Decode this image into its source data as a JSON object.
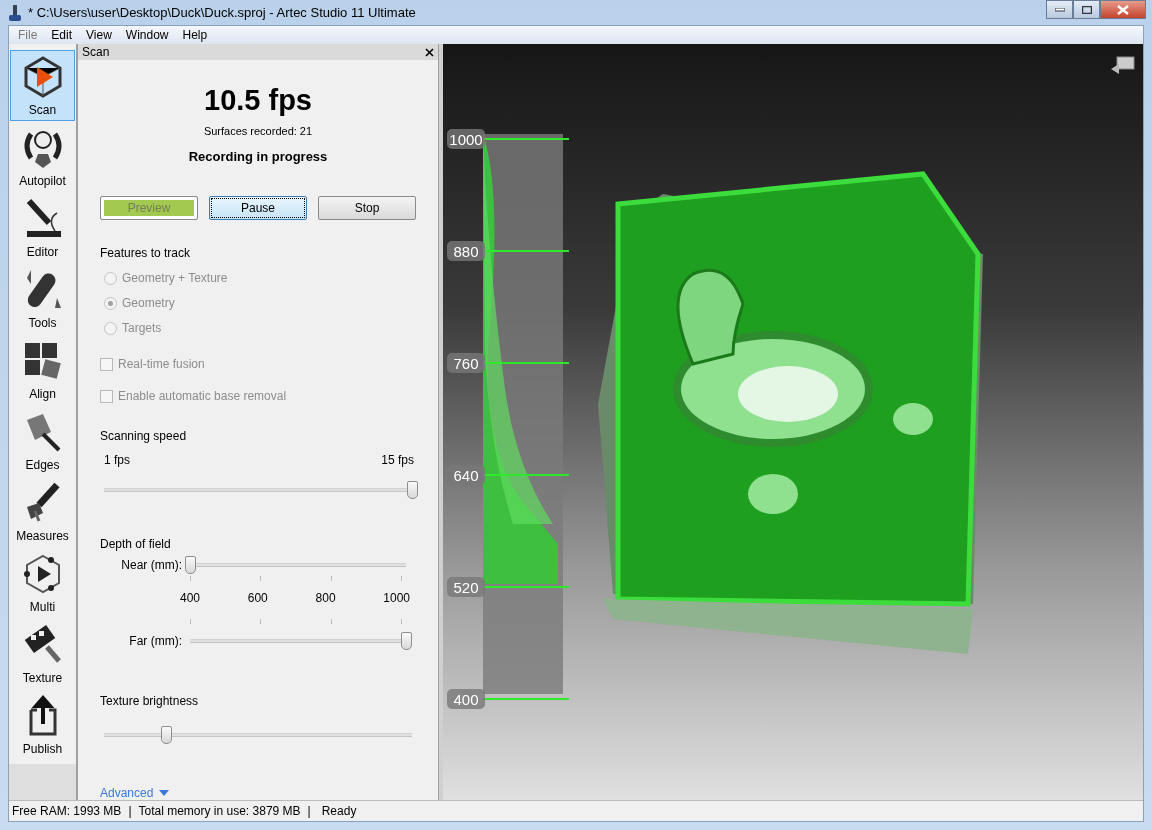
{
  "window": {
    "title": "* C:\\Users\\user\\Desktop\\Duck\\Duck.sproj - Artec Studio 11 Ultimate"
  },
  "menu": [
    {
      "label": "File",
      "disabled": true
    },
    {
      "label": "Edit",
      "disabled": false
    },
    {
      "label": "View",
      "disabled": false
    },
    {
      "label": "Window",
      "disabled": false
    },
    {
      "label": "Help",
      "disabled": false
    }
  ],
  "toolbar": [
    {
      "label": "Scan",
      "selected": true
    },
    {
      "label": "Autopilot",
      "selected": false
    },
    {
      "label": "Editor",
      "selected": false
    },
    {
      "label": "Tools",
      "selected": false
    },
    {
      "label": "Align",
      "selected": false
    },
    {
      "label": "Edges",
      "selected": false
    },
    {
      "label": "Measures",
      "selected": false
    },
    {
      "label": "Multi",
      "selected": false
    },
    {
      "label": "Texture",
      "selected": false
    },
    {
      "label": "Publish",
      "selected": false
    }
  ],
  "panel": {
    "title": "Scan",
    "fps": "10.5 fps",
    "surfaces": "Surfaces recorded: 21",
    "status": "Recording in progress",
    "buttons": [
      {
        "label": "Preview",
        "disabled": true,
        "focused": false,
        "kind": "green"
      },
      {
        "label": "Pause",
        "disabled": false,
        "focused": true,
        "kind": "plain"
      },
      {
        "label": "Stop",
        "disabled": false,
        "focused": false,
        "kind": "plain"
      }
    ],
    "features_label": "Features to track",
    "radios": [
      {
        "label": "Geometry + Texture",
        "selected": false,
        "disabled": true
      },
      {
        "label": "Geometry",
        "selected": true,
        "disabled": true
      },
      {
        "label": "Targets",
        "selected": false,
        "disabled": true
      }
    ],
    "checkboxes": [
      {
        "label": "Real-time fusion",
        "checked": false,
        "disabled": true
      },
      {
        "label": "Enable automatic base removal",
        "checked": false,
        "disabled": true
      }
    ],
    "speed": {
      "label": "Scanning speed",
      "min": "1 fps",
      "max": "15 fps",
      "level": 1.0
    },
    "depth": {
      "label": "Depth of field",
      "near_label": "Near (mm):",
      "near": {
        "level": 0.0
      },
      "ticks": [
        "400",
        "600",
        "800",
        "1000"
      ],
      "far_label": "Far (mm):",
      "far": {
        "level": 1.0
      }
    },
    "brightness": {
      "label": "Texture brightness",
      "level": 0.2
    },
    "advanced": "Advanced"
  },
  "viewport": {
    "depth_scale": [
      "1000",
      "880",
      "760",
      "640",
      "520",
      "400"
    ]
  },
  "status_bar": [
    "Free RAM: 1993 MB",
    "|",
    "Total memory in use: 3879 MB",
    "|",
    "Ready"
  ]
}
